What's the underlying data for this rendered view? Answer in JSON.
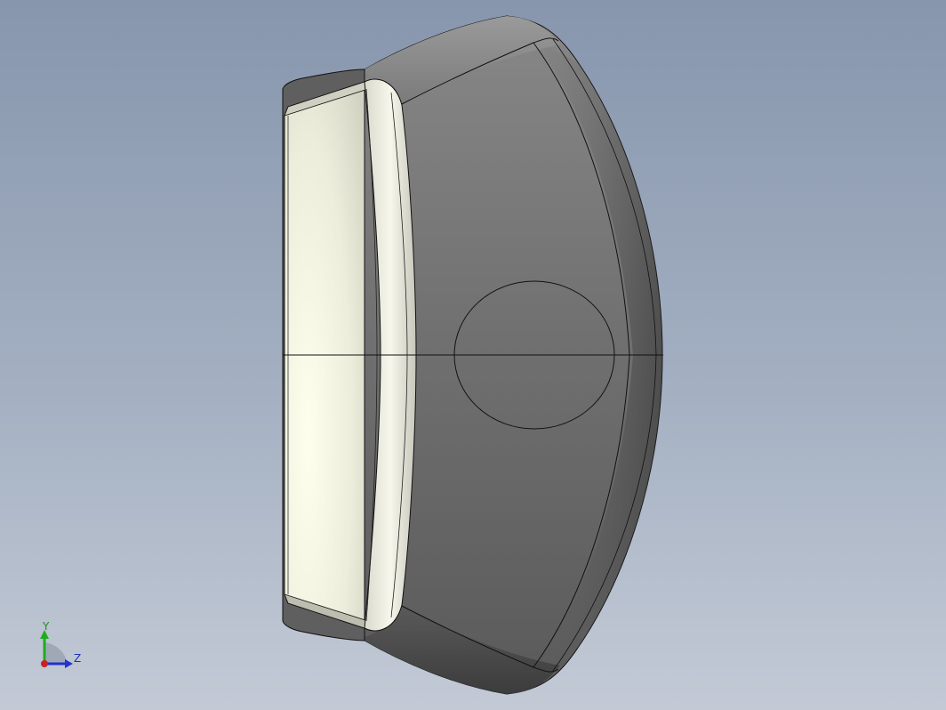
{
  "viewport": {
    "background_top": "#8796ad",
    "background_bottom": "#c3cad6"
  },
  "model": {
    "icon": "cad-part-3d-model",
    "face_dark_color": "#6e6e6e",
    "face_light_color": "#f2f2e0",
    "edge_color": "#111111"
  },
  "triad": {
    "icon": "coordinate-axes-triad",
    "y_label": "Y",
    "z_label": "Z",
    "y_color": "#22aa22",
    "z_color": "#2233cc",
    "origin_color": "#cc2222"
  }
}
